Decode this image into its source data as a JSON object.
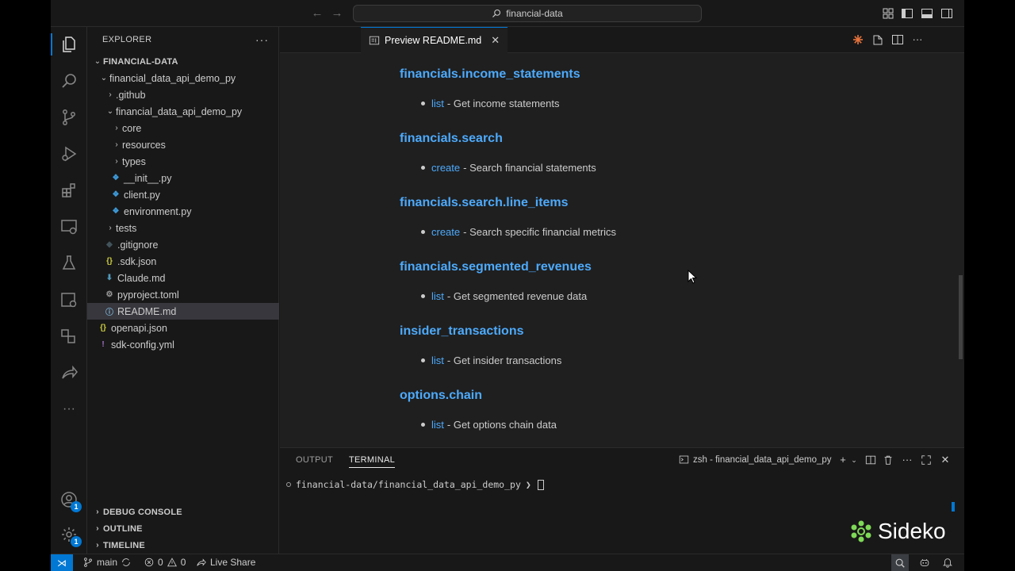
{
  "titlebar": {
    "search_text": "financial-data"
  },
  "explorer": {
    "header": "EXPLORER",
    "root": "FINANCIAL-DATA",
    "tree": [
      {
        "label": "financial_data_api_demo_py",
        "kind": "folder-open",
        "depth": 1
      },
      {
        "label": ".github",
        "kind": "folder",
        "depth": 2
      },
      {
        "label": "financial_data_api_demo_py",
        "kind": "folder-open",
        "depth": 2
      },
      {
        "label": "core",
        "kind": "folder",
        "depth": 3
      },
      {
        "label": "resources",
        "kind": "folder",
        "depth": 3
      },
      {
        "label": "types",
        "kind": "folder",
        "depth": 3
      },
      {
        "label": "__init__.py",
        "kind": "python",
        "depth": 3
      },
      {
        "label": "client.py",
        "kind": "python",
        "depth": 3
      },
      {
        "label": "environment.py",
        "kind": "python",
        "depth": 3
      },
      {
        "label": "tests",
        "kind": "folder",
        "depth": 2
      },
      {
        "label": ".gitignore",
        "kind": "git",
        "depth": 2
      },
      {
        "label": ".sdk.json",
        "kind": "json",
        "depth": 2
      },
      {
        "label": "Claude.md",
        "kind": "markdown",
        "depth": 2
      },
      {
        "label": "pyproject.toml",
        "kind": "toml",
        "depth": 2
      },
      {
        "label": "README.md",
        "kind": "info",
        "depth": 2,
        "selected": true
      },
      {
        "label": "openapi.json",
        "kind": "json",
        "depth": 1
      },
      {
        "label": "sdk-config.yml",
        "kind": "yaml",
        "depth": 1
      }
    ],
    "sections": [
      "DEBUG CONSOLE",
      "OUTLINE",
      "TIMELINE"
    ]
  },
  "editor": {
    "tab_label": "Preview README.md",
    "sections": [
      {
        "heading": "financials.income_statements",
        "method": "list",
        "desc": "- Get income statements"
      },
      {
        "heading": "financials.search",
        "method": "create",
        "desc": "- Search financial statements"
      },
      {
        "heading": "financials.search.line_items",
        "method": "create",
        "desc": "- Search specific financial metrics"
      },
      {
        "heading": "financials.segmented_revenues",
        "method": "list",
        "desc": "- Get segmented revenue data"
      },
      {
        "heading": "insider_transactions",
        "method": "list",
        "desc": "- Get insider transactions"
      },
      {
        "heading": "options.chain",
        "method": "list",
        "desc": "- Get options chain data"
      }
    ]
  },
  "panel": {
    "tabs": [
      "OUTPUT",
      "TERMINAL"
    ],
    "active_tab": "TERMINAL",
    "terminal_name": "zsh - financial_data_api_demo_py",
    "prompt": "financial-data/financial_data_api_demo_py",
    "prompt_symbol": "❯"
  },
  "activity": {
    "accounts_badge": "1",
    "manage_badge": "1"
  },
  "status": {
    "branch": "main",
    "errors": "0",
    "warnings": "0",
    "live_share": "Live Share"
  },
  "watermark": {
    "text": "Sideko"
  },
  "colors": {
    "accent": "#0078d4",
    "link": "#4daafc",
    "python_icon": "#3d9ad8",
    "json_icon": "#cbcb41",
    "markdown_icon": "#519aba",
    "yaml_icon": "#a074c4",
    "watermark_green": "#7ed957"
  }
}
